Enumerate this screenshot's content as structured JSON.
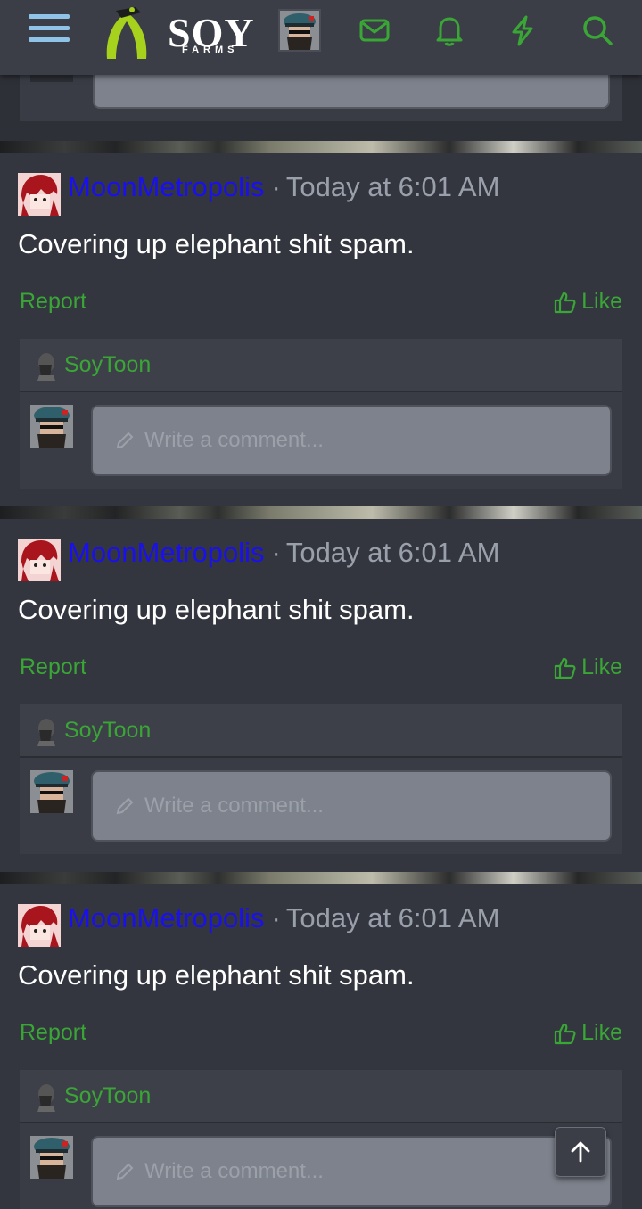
{
  "header": {
    "logo_text": "SOY",
    "logo_sub": "FARMS",
    "icons": [
      "menu-icon",
      "envelope-icon",
      "bell-icon",
      "bolt-icon",
      "search-icon"
    ]
  },
  "posts": [
    {
      "username": "MoonMetropolis",
      "separator": "·",
      "time": "Today at 6:01 AM",
      "body": "Covering up elephant shit spam.",
      "report_label": "Report",
      "like_label": "Like",
      "reply_user": "SoyToon",
      "comment_placeholder": "Write a comment..."
    },
    {
      "username": "MoonMetropolis",
      "separator": "·",
      "time": "Today at 6:01 AM",
      "body": "Covering up elephant shit spam.",
      "report_label": "Report",
      "like_label": "Like",
      "reply_user": "SoyToon",
      "comment_placeholder": "Write a comment..."
    },
    {
      "username": "MoonMetropolis",
      "separator": "·",
      "time": "Today at 6:01 AM",
      "body": "Covering up elephant shit spam.",
      "report_label": "Report",
      "like_label": "Like",
      "reply_user": "SoyToon",
      "comment_placeholder": "Write a comment..."
    }
  ],
  "colors": {
    "accent_green": "#3aa636",
    "username_blue": "#1a10ee",
    "background": "#2e3038"
  }
}
